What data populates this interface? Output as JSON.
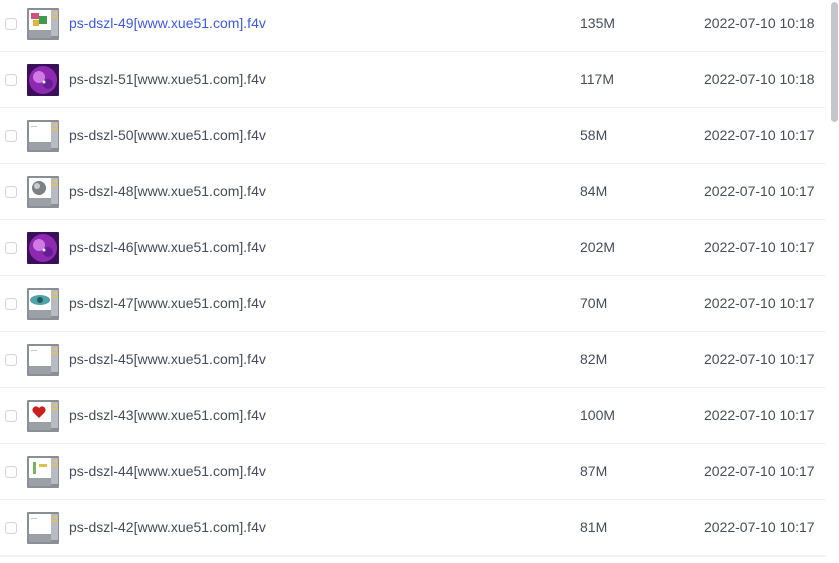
{
  "files": [
    {
      "name": "ps-dszl-49[www.xue51.com].f4v",
      "size": "135M",
      "date": "2022-07-10 10:18",
      "thumb": "screen-thumb-colorful",
      "hover": true
    },
    {
      "name": "ps-dszl-51[www.xue51.com].f4v",
      "size": "117M",
      "date": "2022-07-10 10:18",
      "thumb": "galaxy-purple-thumb",
      "hover": false
    },
    {
      "name": "ps-dszl-50[www.xue51.com].f4v",
      "size": "58M",
      "date": "2022-07-10 10:17",
      "thumb": "screen-thumb-blank",
      "hover": false
    },
    {
      "name": "ps-dszl-48[www.xue51.com].f4v",
      "size": "84M",
      "date": "2022-07-10 10:17",
      "thumb": "screen-thumb-sphere",
      "hover": false
    },
    {
      "name": "ps-dszl-46[www.xue51.com].f4v",
      "size": "202M",
      "date": "2022-07-10 10:17",
      "thumb": "galaxy-purple-thumb",
      "hover": false
    },
    {
      "name": "ps-dszl-47[www.xue51.com].f4v",
      "size": "70M",
      "date": "2022-07-10 10:17",
      "thumb": "screen-thumb-eye",
      "hover": false
    },
    {
      "name": "ps-dszl-45[www.xue51.com].f4v",
      "size": "82M",
      "date": "2022-07-10 10:17",
      "thumb": "screen-thumb-blank",
      "hover": false
    },
    {
      "name": "ps-dszl-43[www.xue51.com].f4v",
      "size": "100M",
      "date": "2022-07-10 10:17",
      "thumb": "screen-thumb-heart",
      "hover": false
    },
    {
      "name": "ps-dszl-44[www.xue51.com].f4v",
      "size": "87M",
      "date": "2022-07-10 10:17",
      "thumb": "screen-thumb-figure",
      "hover": false
    },
    {
      "name": "ps-dszl-42[www.xue51.com].f4v",
      "size": "81M",
      "date": "2022-07-10 10:17",
      "thumb": "screen-thumb-blank",
      "hover": false
    }
  ],
  "colors": {
    "text": "#454d5a",
    "link_hover": "#3c5be0",
    "divider": "#f1f2f4",
    "scrollbar": "#c4c6cb"
  }
}
